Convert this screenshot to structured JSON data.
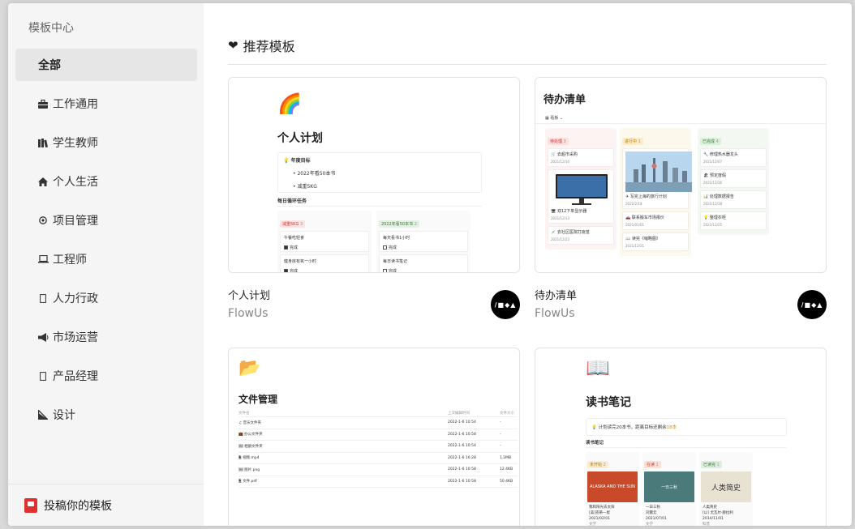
{
  "sidebar": {
    "title": "模板中心",
    "items": [
      {
        "label": "全部",
        "icon": "none"
      },
      {
        "label": "工作通用",
        "icon": "briefcase-icon"
      },
      {
        "label": "学生教师",
        "icon": "books-icon"
      },
      {
        "label": "个人生活",
        "icon": "home-icon"
      },
      {
        "label": "项目管理",
        "icon": "gear-icon"
      },
      {
        "label": "工程师",
        "icon": "laptop-icon"
      },
      {
        "label": "人力行政",
        "icon": "placeholder-icon"
      },
      {
        "label": "市场运营",
        "icon": "megaphone-icon"
      },
      {
        "label": "产品经理",
        "icon": "placeholder-icon"
      },
      {
        "label": "设计",
        "icon": "ruler-icon"
      }
    ],
    "active_index": 0,
    "submit_label": "投稿你的模板"
  },
  "main": {
    "section_title": "推荐模板",
    "cards": [
      {
        "name": "个人计划",
        "author": "FlowUs",
        "preview": {
          "title": "个人计划",
          "goal_title": "年度目标",
          "goals": [
            "2022年看50本书",
            "减重5KG"
          ],
          "sub_title": "每日循环任务",
          "col1_tag": "减重5KG",
          "col1_count": "3",
          "col1_items": [
            "午餐吃轻食",
            "健身房有氧一小时"
          ],
          "col2_tag": "2022年看50本书",
          "col2_count": "2",
          "col2_items": [
            "每天看书1小时",
            "每日读书笔记"
          ],
          "done_label": "完成"
        }
      },
      {
        "name": "待办清单",
        "author": "FlowUs",
        "preview": {
          "title": "待办清单",
          "view_label": "看板",
          "col1_tag": "待处理",
          "col1_count": "3",
          "col1_items": [
            {
              "text": "去超市采购",
              "date": "2021/12/10"
            },
            {
              "text": "双12下单显示器",
              "date": "2021/12/13"
            },
            {
              "text": "去社区医院打疫苗",
              "date": "2021/12/23"
            }
          ],
          "col2_tag": "进行中",
          "col2_count": "1",
          "col2_items": [
            {
              "text": "写完上海的旅行计划",
              "date": "2022/2/18"
            },
            {
              "text": "联系搬车市场报价",
              "date": "2021/01/01"
            },
            {
              "text": "读完《缩略图》",
              "date": "2021/12/21"
            }
          ],
          "col3_tag": "已完成",
          "col3_count": "4",
          "col3_items": [
            {
              "text": "修理热水器龙头",
              "date": "2021/12/07"
            },
            {
              "text": "预定度假",
              "date": "2021/12/16"
            },
            {
              "text": "处理数据报告",
              "date": "2021/12/18"
            },
            {
              "text": "整理衣柜",
              "date": "2021/12/25"
            }
          ]
        }
      },
      {
        "name": "文件管理",
        "preview": {
          "title": "文件管理",
          "headers": [
            "文件名",
            "上次编辑时间",
            "文件大小"
          ],
          "rows": [
            {
              "icon": "music-icon",
              "name": "音乐文件夹",
              "time": "2022-1-6 10:54",
              "size": "-"
            },
            {
              "icon": "briefcase-icon",
              "name": "办公文件夹",
              "time": "2022-1-6 10:58",
              "size": "-"
            },
            {
              "icon": "photo-icon",
              "name": "相册文件夹",
              "time": "2022-1-6 10:54",
              "size": "-"
            },
            {
              "icon": "file-icon",
              "name": "视频.mp4",
              "time": "2022-1-6 16:28",
              "size": "1.2MB"
            },
            {
              "icon": "image-icon",
              "name": "图片.png",
              "time": "2022-1-6 10:58",
              "size": "12.4KB"
            },
            {
              "icon": "file-icon",
              "name": "文件.pdf",
              "time": "2022-1-6 10:58",
              "size": "50.4KB"
            }
          ]
        }
      },
      {
        "name": "读书笔记",
        "preview": {
          "title": "读书笔记",
          "plan_text": "计划读完20本书，距离目标还剩余",
          "plan_count": "18本",
          "sub_title": "读书笔记",
          "cols": [
            {
              "tag": "未开始",
              "count": "2",
              "cover": "ALASKA AND THE SUN",
              "cover_color": "#c94a2b",
              "title": "我和阳光去太阳",
              "author": "[美]克蒂一屋",
              "date": "2021/02/01",
              "label": "文学"
            },
            {
              "tag": "在读",
              "count": "1",
              "cover": "一日三秋",
              "cover_color": "#4a7a7a",
              "title": "一日三秋",
              "author": "刘震云",
              "date": "2021/07/01",
              "label": "文学"
            },
            {
              "tag": "已读完",
              "count": "1",
              "cover": "人类简史",
              "cover_color": "#e8e2d3",
              "title": "人类简史",
              "author": "[以] 尤瓦尔·赫拉利",
              "date": "2014/11/01",
              "label": "科普"
            }
          ]
        }
      }
    ],
    "avatar_text": "/■◆▲"
  }
}
